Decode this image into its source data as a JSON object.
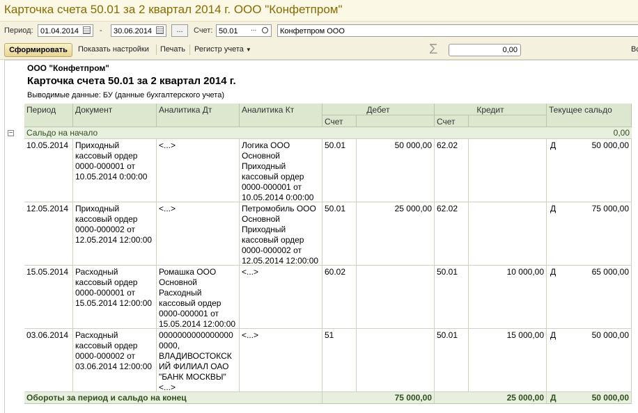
{
  "window": {
    "title": "Карточка счета 50.01 за 2 квартал 2014 г. ООО \"Конфетпром\""
  },
  "params": {
    "period_label": "Период:",
    "date_from": "01.04.2014",
    "dash": "-",
    "date_to": "30.06.2014",
    "dots": "...",
    "account_label": "Счет:",
    "account_value": "50.01",
    "org_value": "Конфетпром ООО"
  },
  "toolbar": {
    "generate_label": "Сформировать",
    "show_settings_label": "Показать настройки",
    "print_label": "Печать",
    "register_label": "Регистр учета",
    "sum_value": "0,00",
    "right_cut": "Вс"
  },
  "report": {
    "org": "ООО \"Конфетпром\"",
    "title": "Карточка счета 50.01 за 2 квартал 2014 г.",
    "output_data": "Выводимые данные:  БУ (данные бухгалтерского учета)",
    "headers": {
      "period": "Период",
      "document": "Документ",
      "analytics_dt": "Аналитика Дт",
      "analytics_kt": "Аналитика Кт",
      "debit": "Дебет",
      "credit": "Кредит",
      "balance": "Текущее сальдо",
      "debit_account": "Счет",
      "credit_account": "Счет"
    },
    "opening": {
      "label": "Сальдо на начало",
      "value": "0,00"
    },
    "rows": [
      {
        "date": "10.05.2014",
        "document": "Приходный\nкассовый ордер\n0000-000001 от\n10.05.2014 0:00:00",
        "analytics_dt": "<...>",
        "analytics_kt": "Логика ООО\nОсновной\nПриходный\nкассовый ордер\n0000-000001 от\n10.05.2014 0:00:00",
        "debit_account": "50.01",
        "debit_amount": "50 000,00",
        "credit_account": "62.02",
        "credit_amount": "",
        "balance_side": "Д",
        "balance_amount": "50 000,00"
      },
      {
        "date": "12.05.2014",
        "document": "Приходный\nкассовый ордер\n0000-000002 от\n12.05.2014 12:00:00",
        "analytics_dt": "<...>",
        "analytics_kt": "Петромобиль ООО\nОсновной\nПриходный\nкассовый ордер\n0000-000002 от\n12.05.2014 12:00:00",
        "debit_account": "50.01",
        "debit_amount": "25 000,00",
        "credit_account": "62.02",
        "credit_amount": "",
        "balance_side": "Д",
        "balance_amount": "75 000,00"
      },
      {
        "date": "15.05.2014",
        "document": "Расходный\nкассовый ордер\n0000-000001 от\n15.05.2014 12:00:00",
        "analytics_dt": "Ромашка ООО\nОсновной\nРасходный\nкассовый ордер\n0000-000001 от\n15.05.2014 12:00:00",
        "analytics_kt": "<...>",
        "debit_account": "60.02",
        "debit_amount": "",
        "credit_account": "50.01",
        "credit_amount": "10 000,00",
        "balance_side": "Д",
        "balance_amount": "65 000,00"
      },
      {
        "date": "03.06.2014",
        "document": "Расходный\nкассовый ордер\n0000-000002 от\n03.06.2014 12:00:00",
        "analytics_dt": "0000000000000000\n0000,\nВЛАДИВОСТОКСК\nИЙ ФИЛИАЛ ОАО\n\"БАНК МОСКВЫ\"\n<...>",
        "analytics_kt": "<...>",
        "debit_account": "51",
        "debit_amount": "",
        "credit_account": "50.01",
        "credit_amount": "15 000,00",
        "balance_side": "Д",
        "balance_amount": "50 000,00"
      }
    ],
    "totals": {
      "label": "Обороты за период и сальдо на конец",
      "debit": "75 000,00",
      "credit": "25 000,00",
      "side": "Д",
      "balance": "50 000,00"
    }
  }
}
